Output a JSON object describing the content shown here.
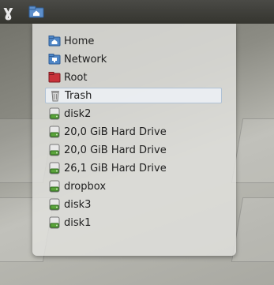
{
  "panel": {
    "logo_glyph": "ɣ",
    "home_icon": "home-folder-icon"
  },
  "menu": {
    "items": [
      {
        "label": "Home",
        "icon": "home-folder-icon"
      },
      {
        "label": "Network",
        "icon": "network-folder-icon"
      },
      {
        "label": "Root",
        "icon": "root-folder-icon"
      },
      {
        "label": "Trash",
        "icon": "trash-icon",
        "selected": true
      },
      {
        "label": "disk2",
        "icon": "drive-icon"
      },
      {
        "label": "20,0 GiB Hard Drive",
        "icon": "drive-icon"
      },
      {
        "label": "20,0 GiB Hard Drive",
        "icon": "drive-icon"
      },
      {
        "label": "26,1 GiB Hard Drive",
        "icon": "drive-icon"
      },
      {
        "label": "dropbox",
        "icon": "drive-icon"
      },
      {
        "label": "disk3",
        "icon": "drive-icon"
      },
      {
        "label": "disk1",
        "icon": "drive-icon"
      }
    ]
  },
  "colors": {
    "folder_blue": "#4f86c6",
    "root_red": "#c8323a",
    "drive_green": "#5aa43a"
  }
}
